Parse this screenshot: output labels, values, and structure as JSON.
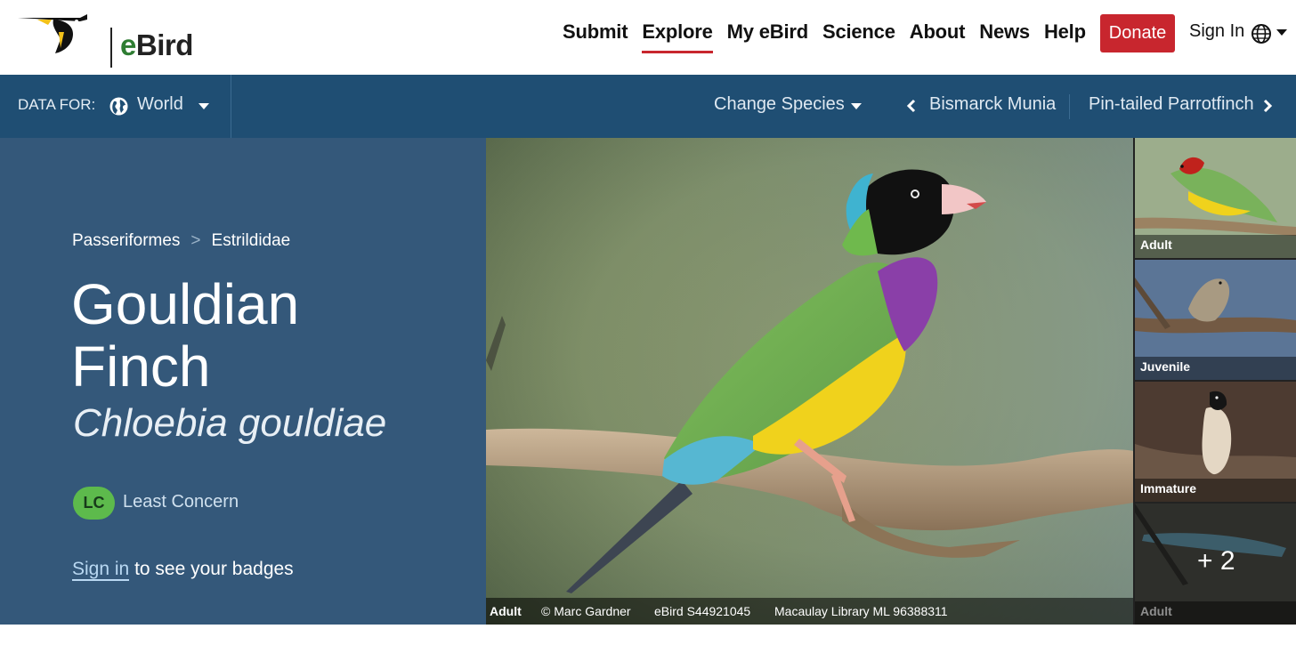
{
  "header": {
    "brand": "eBird",
    "nav": [
      "Submit",
      "Explore",
      "My eBird",
      "Science",
      "About",
      "News",
      "Help"
    ],
    "active_nav": "Explore",
    "donate_label": "Donate",
    "signin_label": "Sign In",
    "accent_color": "#c8262e"
  },
  "subbar": {
    "data_for_label": "DATA FOR:",
    "region": "World",
    "change_species_label": "Change Species",
    "prev_species": "Bismarck Munia",
    "next_species": "Pin-tailed Parrotfinch",
    "background_color": "#1f4e73"
  },
  "species": {
    "order": "Passeriformes",
    "family": "Estrildidae",
    "breadcrumb_separator": ">",
    "common_name": "Gouldian Finch",
    "scientific_name": "Chloebia gouldiae",
    "conservation_code": "LC",
    "conservation_status": "Least Concern",
    "signin_link": "Sign in",
    "signin_suffix": "to see your badges"
  },
  "photo": {
    "age": "Adult",
    "credit": "© Marc Gardner",
    "checklist": "eBird S44921045",
    "library": "Macaulay Library ML 96388311"
  },
  "thumbnails": [
    {
      "label": "Adult"
    },
    {
      "label": "Juvenile"
    },
    {
      "label": "Immature"
    },
    {
      "label": "Adult",
      "more": "+ 2"
    }
  ]
}
